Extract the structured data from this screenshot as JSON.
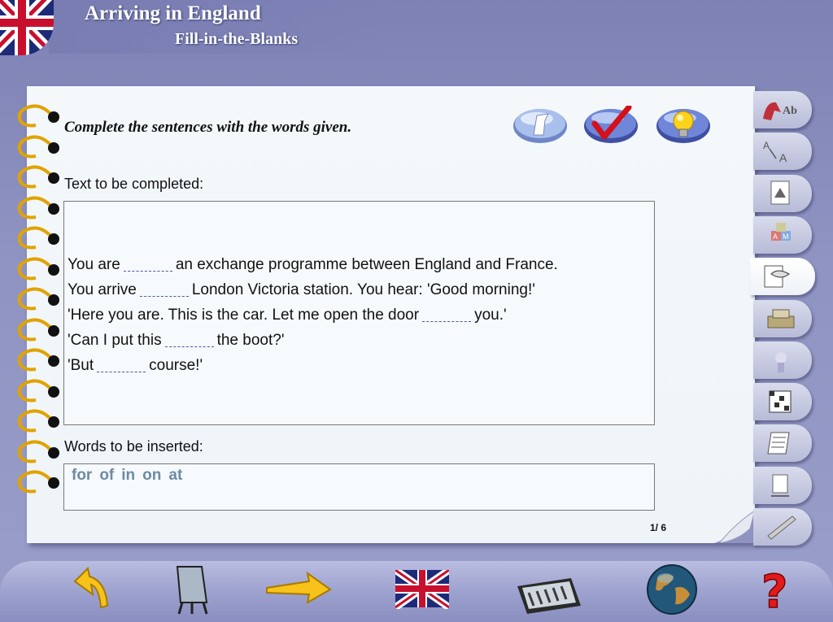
{
  "header": {
    "title": "Arriving in England",
    "subtitle": "Fill-in-the-Blanks"
  },
  "exercise": {
    "instruction": "Complete the sentences with the words given.",
    "text_label": "Text to be completed:",
    "words_label": "Words to be inserted:",
    "lines": [
      {
        "before": "You are",
        "after": "an exchange programme between England and France."
      },
      {
        "before": "You arrive",
        "after": "London Victoria station. You hear: 'Good morning!'"
      },
      {
        "before": "'Here you are. This is the car. Let me open the door",
        "after": "you.'"
      },
      {
        "before": "'Can I put this",
        "after": "the boot?'"
      },
      {
        "before": "'But",
        "after": "course!'"
      }
    ],
    "words": [
      "for",
      "of",
      "in",
      "on",
      "at"
    ],
    "page_indicator": "1/ 6"
  },
  "toolbar": {
    "buttons": [
      "eraser-icon",
      "check-icon",
      "lightbulb-icon"
    ]
  },
  "side_tabs": [
    {
      "icon": "vocabulary-ab-icon",
      "text": "Ab"
    },
    {
      "icon": "pronunciation-aa-icon",
      "text": "A"
    },
    {
      "icon": "picture-dictionary-icon"
    },
    {
      "icon": "alphabet-blocks-icon",
      "text": "AM"
    },
    {
      "icon": "fill-in-blanks-icon",
      "active": true
    },
    {
      "icon": "typewriter-icon"
    },
    {
      "icon": "listening-icon"
    },
    {
      "icon": "crossword-icon"
    },
    {
      "icon": "document-icon"
    },
    {
      "icon": "test-icon"
    },
    {
      "icon": "writing-icon"
    }
  ],
  "bottom_nav": [
    "back-arrow-icon",
    "board-icon",
    "forward-arrow-icon",
    "union-jack-flag-icon",
    "keyboard-settings-icon",
    "globe-icon",
    "help-icon"
  ],
  "colors": {
    "background": "#8f93c2",
    "notebook": "#f4f8fb",
    "words": "#6d8aa6",
    "blank": "#4a55a0"
  }
}
